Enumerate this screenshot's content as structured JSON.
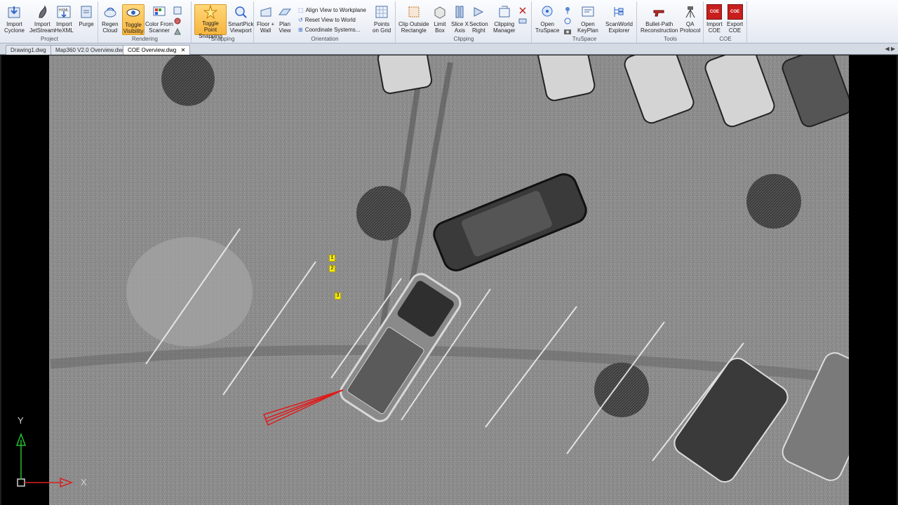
{
  "ribbon": {
    "project": {
      "label": "Project",
      "buttons": [
        "Import\nCyclone",
        "Import\nJetStream",
        "Import\nHeXML",
        "Purge"
      ]
    },
    "rendering": {
      "label": "Rendering",
      "buttons": [
        "Regen\nCloud",
        "Toggle\nVisibility",
        "Color From\nScanner"
      ]
    },
    "snapping": {
      "label": "Snapping",
      "buttons": [
        "Toggle Point\nSnapping",
        "SmartPick\nViewport"
      ]
    },
    "orientation": {
      "label": "Orientation",
      "buttons": [
        "Floor +\nWall",
        "Plan\nView"
      ],
      "small": [
        "Align View to Workplane",
        "Reset View to World",
        "Coordinate Systems..."
      ],
      "extra": "Points\non Grid"
    },
    "clipping": {
      "label": "Clipping",
      "buttons": [
        "Clip Outside\nRectangle",
        "Limit\nBox",
        "Slice X\nAxis",
        "Section\nRight",
        "Clipping\nManager"
      ]
    },
    "truspace": {
      "label": "TruSpace",
      "buttons": [
        "Open\nTruSpace",
        "Open\nKeyPlan",
        "ScanWorld\nExplorer"
      ]
    },
    "tools": {
      "label": "Tools",
      "buttons": [
        "Bullet-Path\nReconstruction",
        "QA\nProtocol"
      ]
    },
    "coe": {
      "label": "COE",
      "buttons": [
        "Import\nCOE",
        "Export\nCOE"
      ],
      "icon_text": "COE"
    }
  },
  "tabs": [
    {
      "label": "Drawing1.dwg"
    },
    {
      "label": "Map360 V2.0 Overview.dwg"
    },
    {
      "label": "COE Overview.dwg",
      "active": true,
      "close": "✕"
    }
  ],
  "viewport": {
    "markers": [
      "1",
      "2",
      "3"
    ],
    "ucs": {
      "x": "X",
      "y": "Y"
    }
  },
  "colors": {
    "ribbon_bg": "#e8edf4",
    "active_button": "#f7b53e",
    "marker": "#f5e90f",
    "trajectory": "#e01b1b",
    "ucs_x": "#d82020",
    "ucs_y": "#20c030"
  }
}
